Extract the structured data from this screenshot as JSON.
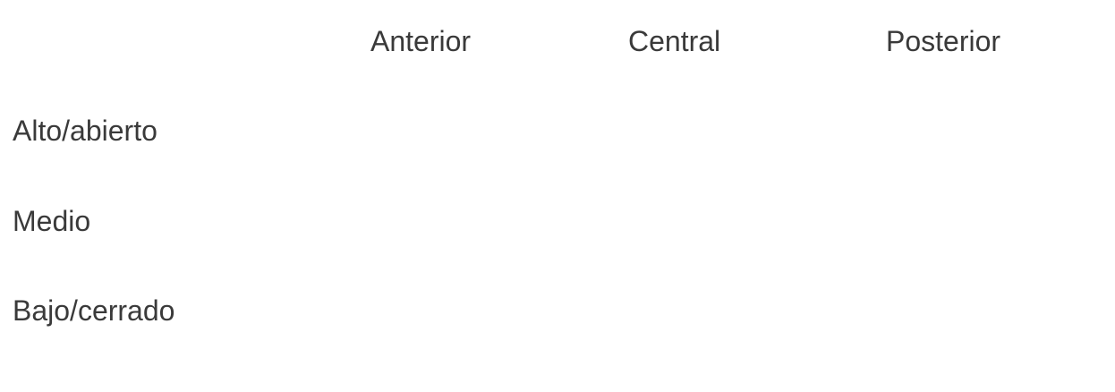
{
  "table": {
    "column_headers": [
      "Anterior",
      "Central",
      "Posterior"
    ],
    "row_headers": [
      "Alto/abierto",
      "Medio",
      "Bajo/cerrado"
    ]
  }
}
